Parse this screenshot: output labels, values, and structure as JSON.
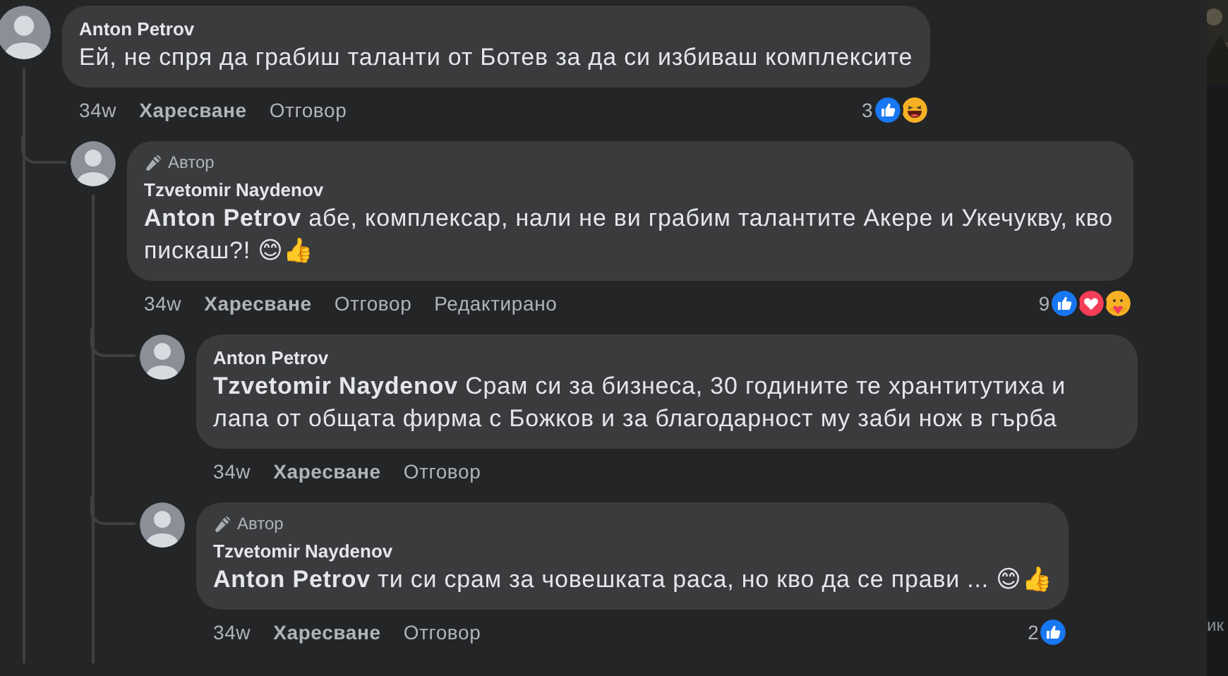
{
  "comments": [
    {
      "author": "Anton Petrov",
      "body": "Ей, не спря да грабиш таланти от Ботев за да си избиваш комплексите",
      "time": "34w",
      "actions": [
        {
          "label": "Харесване",
          "kind": "like"
        },
        {
          "label": "Отговор",
          "kind": "reply"
        }
      ],
      "reaction_count": "3",
      "reactions": [
        {
          "kind": "like"
        },
        {
          "kind": "haha"
        }
      ],
      "replies": [
        {
          "author": "Tzvetomir Naydenov",
          "badge": "Автор",
          "body": "**Anton Petrov** абе, комплексар, нали не ви грабим талантите Акере и Укечукву, кво пискаш?! 😊👍",
          "time": "34w",
          "actions": [
            {
              "label": "Харесване",
              "kind": "like"
            },
            {
              "label": "Отговор",
              "kind": "reply"
            },
            {
              "label": "Редактирано",
              "kind": "note"
            }
          ],
          "reaction_count": "9",
          "reactions": [
            {
              "kind": "like"
            },
            {
              "kind": "love"
            },
            {
              "kind": "care"
            }
          ],
          "replies": [
            {
              "author": "Anton Petrov",
              "body": "**Tzvetomir Naydenov** Срам си за бизнеса, 30 годините те хрантитутиха и лапа от общата фирма с Божков и за благодарност му заби нож в гърба",
              "time": "34w",
              "actions": [
                {
                  "label": "Харесване",
                  "kind": "like"
                },
                {
                  "label": "Отговор",
                  "kind": "reply"
                }
              ]
            },
            {
              "author": "Tzvetomir Naydenov",
              "badge": "Автор",
              "body": "**Anton Petrov** ти си срам за човешката раса, но кво да се прави ... 😊👍",
              "time": "34w",
              "actions": [
                {
                  "label": "Харесване",
                  "kind": "like"
                },
                {
                  "label": "Отговор",
                  "kind": "reply"
                }
              ],
              "reaction_count": "2",
              "reactions": [
                {
                  "kind": "like"
                }
              ]
            }
          ]
        }
      ]
    }
  ],
  "side_panel": {
    "text": "ик"
  }
}
